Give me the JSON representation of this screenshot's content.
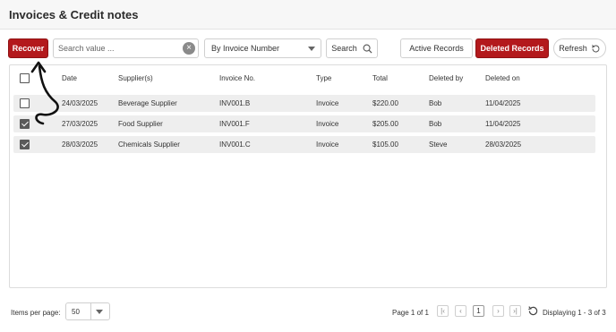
{
  "page": {
    "title": "Invoices & Credit notes"
  },
  "toolbar": {
    "recover_label": "Recover",
    "search_placeholder": "Search value ...",
    "filter_selected": "By Invoice Number",
    "search_label": "Search",
    "active_label": "Active Records",
    "deleted_label": "Deleted Records",
    "refresh_label": "Refresh"
  },
  "table": {
    "columns": [
      "Date",
      "Supplier(s)",
      "Invoice No.",
      "Type",
      "Total",
      "Deleted by",
      "Deleted on"
    ],
    "rows": [
      {
        "checked": false,
        "date": "24/03/2025",
        "supplier": "Beverage Supplier",
        "invoice": "INV001.B",
        "type": "Invoice",
        "total": "$220.00",
        "deleted_by": "Bob",
        "deleted_on": "11/04/2025"
      },
      {
        "checked": true,
        "date": "27/03/2025",
        "supplier": "Food Supplier",
        "invoice": "INV001.F",
        "type": "Invoice",
        "total": "$205.00",
        "deleted_by": "Bob",
        "deleted_on": "11/04/2025"
      },
      {
        "checked": true,
        "date": "28/03/2025",
        "supplier": "Chemicals Supplier",
        "invoice": "INV001.C",
        "type": "Invoice",
        "total": "$105.00",
        "deleted_by": "Steve",
        "deleted_on": "28/03/2025"
      }
    ]
  },
  "footer": {
    "items_per_page_label": "Items per page:",
    "items_per_page_value": "50",
    "page_label": "Page 1 of 1",
    "current_page": "1",
    "displaying_label": "Displaying 1 - 3 of 3"
  },
  "colors": {
    "accent": "#b3191c",
    "row_bg": "#eeeeee"
  }
}
